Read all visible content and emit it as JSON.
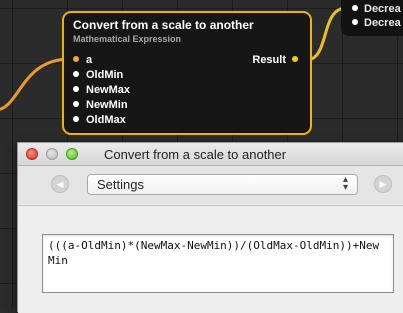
{
  "side_node": {
    "ports": [
      "Decrea",
      "Decrea"
    ]
  },
  "node": {
    "title": "Convert from a scale to another",
    "subtitle": "Mathematical Expression",
    "inputs": [
      "a",
      "OldMin",
      "NewMax",
      "NewMin",
      "OldMax"
    ],
    "output": "Result"
  },
  "window": {
    "title": "Convert from a scale to another",
    "settings_select": "Settings",
    "select_arrows": "↕",
    "left_button_icon": "◀",
    "right_button_icon": "▶",
    "expression": "(((a-OldMin)*(NewMax-NewMin))/(OldMax-OldMin))+NewMin"
  },
  "colors": {
    "node_border": "#f0b400",
    "input_a_port": "#f0a838",
    "result_port": "#f0d000",
    "wire": "#e89a2c"
  }
}
